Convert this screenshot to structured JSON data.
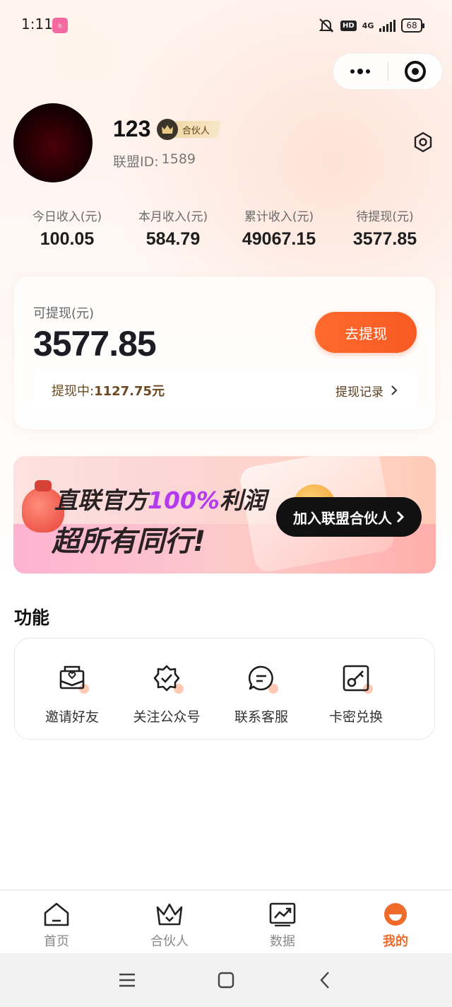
{
  "status_bar": {
    "time": "1:11",
    "app_badge": "bilibili",
    "hd": "HD",
    "network": "4G",
    "battery": "68"
  },
  "profile": {
    "username": "123",
    "badge": "合伙人",
    "id_label": "联盟ID:",
    "id_value": "1589"
  },
  "stats": [
    {
      "label": "今日收入(元)",
      "value": "100.05"
    },
    {
      "label": "本月收入(元)",
      "value": "584.79"
    },
    {
      "label": "累计收入(元)",
      "value": "49067.15"
    },
    {
      "label": "待提现(元)",
      "value": "3577.85"
    }
  ],
  "withdraw": {
    "label": "可提现(元)",
    "amount": "3577.85",
    "button": "去提现",
    "pending_label": "提现中:",
    "pending_value": "1127.75元",
    "records": "提现记录"
  },
  "banner": {
    "line1_a": "直联官方",
    "line1_pct": "100%",
    "line1_b": "利润",
    "line2": "超所有同行!",
    "button": "加入联盟合伙人"
  },
  "features": {
    "title": "功能",
    "items": [
      {
        "label": "邀请好友",
        "icon": "invite-envelope-icon"
      },
      {
        "label": "关注公众号",
        "icon": "verified-badge-icon"
      },
      {
        "label": "联系客服",
        "icon": "chat-bubble-icon"
      },
      {
        "label": "卡密兑换",
        "icon": "key-card-icon"
      }
    ]
  },
  "tabbar": {
    "items": [
      {
        "label": "首页",
        "icon": "home-icon",
        "active": false
      },
      {
        "label": "合伙人",
        "icon": "crown-icon",
        "active": false
      },
      {
        "label": "数据",
        "icon": "chart-icon",
        "active": false
      },
      {
        "label": "我的",
        "icon": "profile-icon",
        "active": true
      }
    ]
  },
  "colors": {
    "accent": "#f75a22",
    "active_tab": "#f06a2a",
    "banner_highlight": "#b43af0"
  }
}
